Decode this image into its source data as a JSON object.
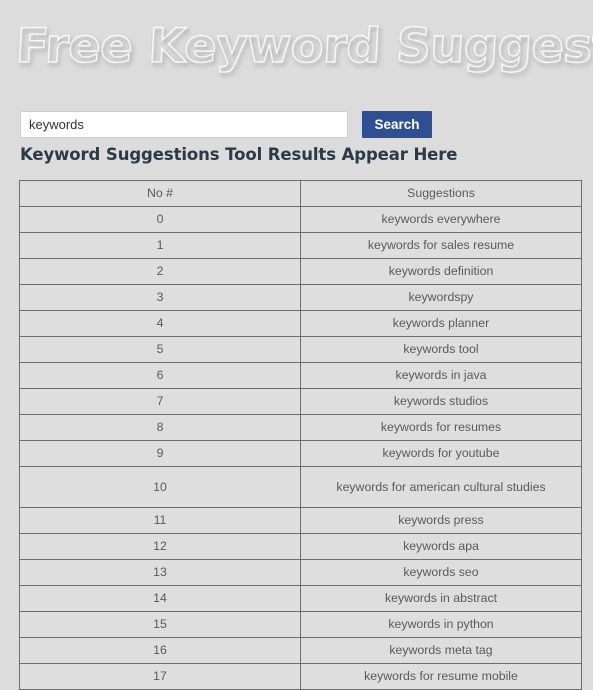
{
  "banner": {
    "title": "Free Keyword Suggestions Tool!",
    "text_texture": "marble-wood-orange-brown",
    "shadow_color": "#5a5a5a"
  },
  "colors": {
    "page_background": "#dcdcdc",
    "button_blue": "#2f4f92",
    "heading_text": "#2b3a46",
    "table_border": "#6e6e6e",
    "table_cell_background": "#dedede",
    "table_text": "#5a5a5a",
    "input_background": "#ffffff",
    "input_border": "#cfcfcf"
  },
  "search": {
    "value": "keywords",
    "placeholder": "keywords",
    "button_label": "Search"
  },
  "results": {
    "heading": "Keyword Suggestions Tool Results Appear Here",
    "columns": [
      "No #",
      "Suggestions"
    ],
    "rows": [
      {
        "no": "0",
        "suggestion": "keywords everywhere"
      },
      {
        "no": "1",
        "suggestion": "keywords for sales resume"
      },
      {
        "no": "2",
        "suggestion": "keywords definition"
      },
      {
        "no": "3",
        "suggestion": "keywordspy"
      },
      {
        "no": "4",
        "suggestion": "keywords planner"
      },
      {
        "no": "5",
        "suggestion": "keywords tool"
      },
      {
        "no": "6",
        "suggestion": "keywords in java"
      },
      {
        "no": "7",
        "suggestion": "keywords studios"
      },
      {
        "no": "8",
        "suggestion": "keywords for resumes"
      },
      {
        "no": "9",
        "suggestion": "keywords for youtube"
      },
      {
        "no": "10",
        "suggestion": "keywords for american cultural studies"
      },
      {
        "no": "11",
        "suggestion": "keywords press"
      },
      {
        "no": "12",
        "suggestion": "keywords apa"
      },
      {
        "no": "13",
        "suggestion": "keywords seo"
      },
      {
        "no": "14",
        "suggestion": "keywords in abstract"
      },
      {
        "no": "15",
        "suggestion": "keywords in python"
      },
      {
        "no": "16",
        "suggestion": "keywords meta tag"
      },
      {
        "no": "17",
        "suggestion": "keywords for resume mobile"
      }
    ]
  }
}
